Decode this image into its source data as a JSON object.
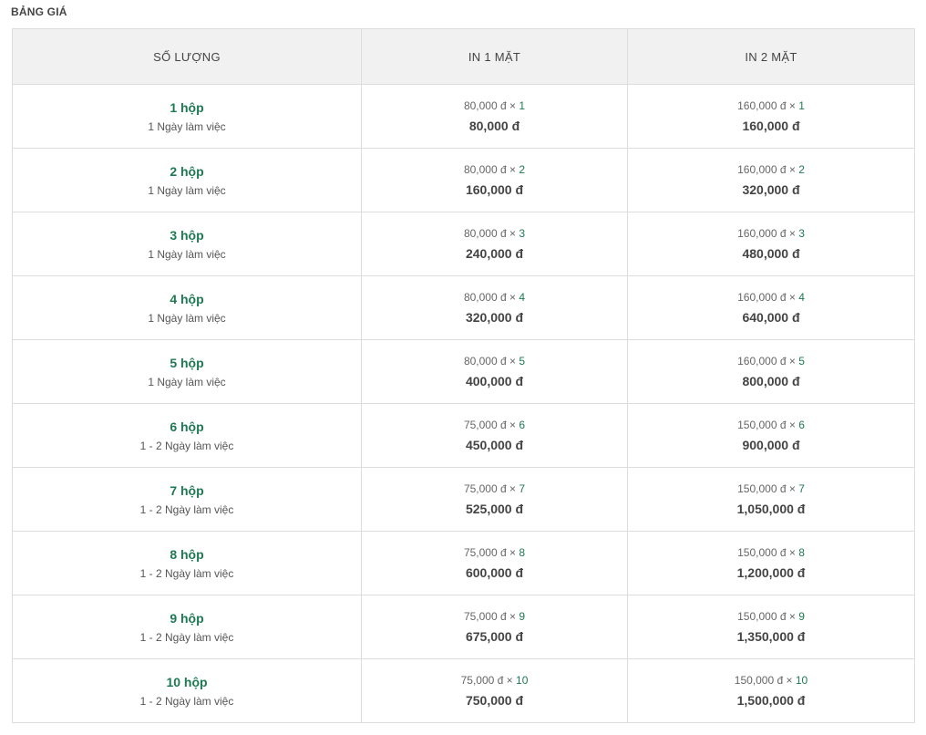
{
  "page": {
    "title": "BẢNG GIÁ"
  },
  "table": {
    "headers": [
      "SỐ LƯỢNG",
      "IN 1 MẶT",
      "IN 2 MẶT"
    ],
    "rows": [
      {
        "qty": "1 hộp",
        "days": "1 Ngày làm việc",
        "one_side": {
          "unit": "80,000 đ",
          "times": "×",
          "mult": "1",
          "total": "80,000 đ"
        },
        "two_side": {
          "unit": "160,000 đ",
          "times": "×",
          "mult": "1",
          "total": "160,000 đ"
        }
      },
      {
        "qty": "2 hộp",
        "days": "1 Ngày làm việc",
        "one_side": {
          "unit": "80,000 đ",
          "times": "×",
          "mult": "2",
          "total": "160,000 đ"
        },
        "two_side": {
          "unit": "160,000 đ",
          "times": "×",
          "mult": "2",
          "total": "320,000 đ"
        }
      },
      {
        "qty": "3 hộp",
        "days": "1 Ngày làm việc",
        "one_side": {
          "unit": "80,000 đ",
          "times": "×",
          "mult": "3",
          "total": "240,000 đ"
        },
        "two_side": {
          "unit": "160,000 đ",
          "times": "×",
          "mult": "3",
          "total": "480,000 đ"
        }
      },
      {
        "qty": "4 hộp",
        "days": "1 Ngày làm việc",
        "one_side": {
          "unit": "80,000 đ",
          "times": "×",
          "mult": "4",
          "total": "320,000 đ"
        },
        "two_side": {
          "unit": "160,000 đ",
          "times": "×",
          "mult": "4",
          "total": "640,000 đ"
        }
      },
      {
        "qty": "5 hộp",
        "days": "1 Ngày làm việc",
        "one_side": {
          "unit": "80,000 đ",
          "times": "×",
          "mult": "5",
          "total": "400,000 đ"
        },
        "two_side": {
          "unit": "160,000 đ",
          "times": "×",
          "mult": "5",
          "total": "800,000 đ"
        }
      },
      {
        "qty": "6 hộp",
        "days": "1 - 2 Ngày làm việc",
        "one_side": {
          "unit": "75,000 đ",
          "times": "×",
          "mult": "6",
          "total": "450,000 đ"
        },
        "two_side": {
          "unit": "150,000 đ",
          "times": "×",
          "mult": "6",
          "total": "900,000 đ"
        }
      },
      {
        "qty": "7 hộp",
        "days": "1 - 2 Ngày làm việc",
        "one_side": {
          "unit": "75,000 đ",
          "times": "×",
          "mult": "7",
          "total": "525,000 đ"
        },
        "two_side": {
          "unit": "150,000 đ",
          "times": "×",
          "mult": "7",
          "total": "1,050,000 đ"
        }
      },
      {
        "qty": "8 hộp",
        "days": "1 - 2 Ngày làm việc",
        "one_side": {
          "unit": "75,000 đ",
          "times": "×",
          "mult": "8",
          "total": "600,000 đ"
        },
        "two_side": {
          "unit": "150,000 đ",
          "times": "×",
          "mult": "8",
          "total": "1,200,000 đ"
        }
      },
      {
        "qty": "9 hộp",
        "days": "1 - 2 Ngày làm việc",
        "one_side": {
          "unit": "75,000 đ",
          "times": "×",
          "mult": "9",
          "total": "675,000 đ"
        },
        "two_side": {
          "unit": "150,000 đ",
          "times": "×",
          "mult": "9",
          "total": "1,350,000 đ"
        }
      },
      {
        "qty": "10 hộp",
        "days": "1 - 2 Ngày làm việc",
        "one_side": {
          "unit": "75,000 đ",
          "times": "×",
          "mult": "10",
          "total": "750,000 đ"
        },
        "two_side": {
          "unit": "150,000 đ",
          "times": "×",
          "mult": "10",
          "total": "1,500,000 đ"
        }
      }
    ]
  },
  "colors": {
    "accent_green": "#1d7a52",
    "header_bg": "#f1f1f1",
    "border": "#dddddd"
  }
}
